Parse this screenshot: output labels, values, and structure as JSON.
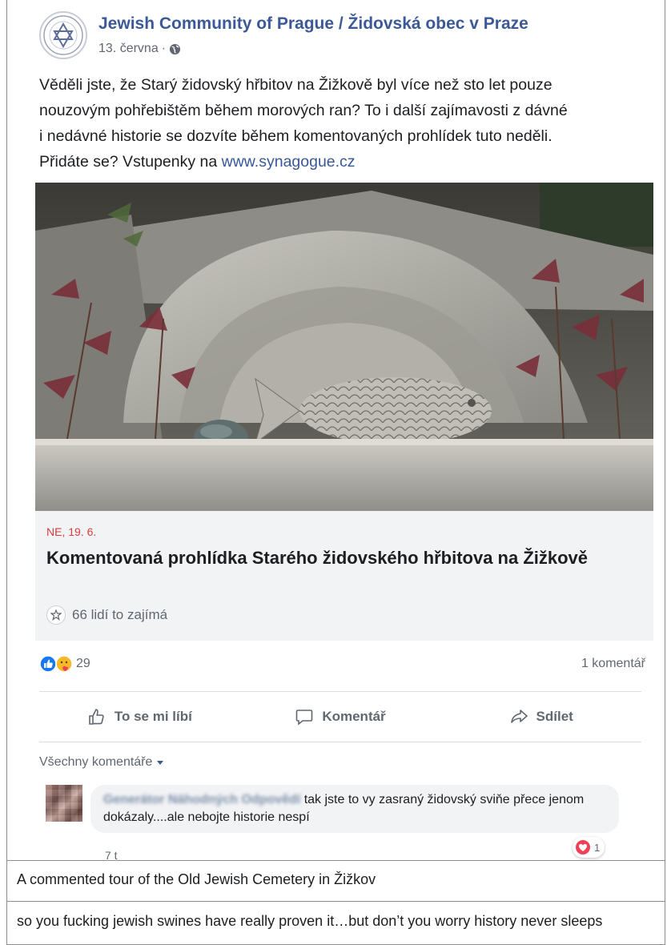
{
  "post": {
    "page_name": "Jewish Community of Prague / Židovská obec v Praze",
    "date": "13. června",
    "separator": "·",
    "text": "Věděli jste, že Starý židovský hřbitov na Žižkově byl více než sto let pouze\nnouzovým pohřebištěm během morových ran? To i další zajímavosti z dávné\ni nedávné historie se dozvíte během komentovaných prohlídek tuto neděli.\nPřidáte se? Vstupenky na ",
    "link": "www.synagogue.cz"
  },
  "event": {
    "date": "NE, 19. 6.",
    "title": "Komentovaná prohlídka Starého židovského hřbitova na Žižkově",
    "interest": "66 lidí to zajímá"
  },
  "stats": {
    "reaction_count": "29",
    "comment_count": "1 komentář"
  },
  "actions": {
    "like": "To se mi líbí",
    "comment": "Komentář",
    "share": "Sdílet"
  },
  "comments": {
    "filter_label": "Všechny komentáře",
    "items": [
      {
        "author": "Generátor Náhodných Odpovědí",
        "text": " tak jste to vy zasraný židovský sviňe přece jenom dokázaly....ale nebojte historie nespí",
        "time": "7 t",
        "reaction_count": "1"
      }
    ]
  },
  "captions": {
    "event_translation": "A commented tour of the Old Jewish Cemetery in Žižkov",
    "comment_translation": "so you fucking jewish swines have really proven it…but don’t you worry history never sleeps"
  },
  "colors": {
    "link": "#385898",
    "page_name": "#3b5998",
    "event_date": "#e0393e",
    "like_blue": "#1877f2",
    "love_red": "#f33e58"
  }
}
